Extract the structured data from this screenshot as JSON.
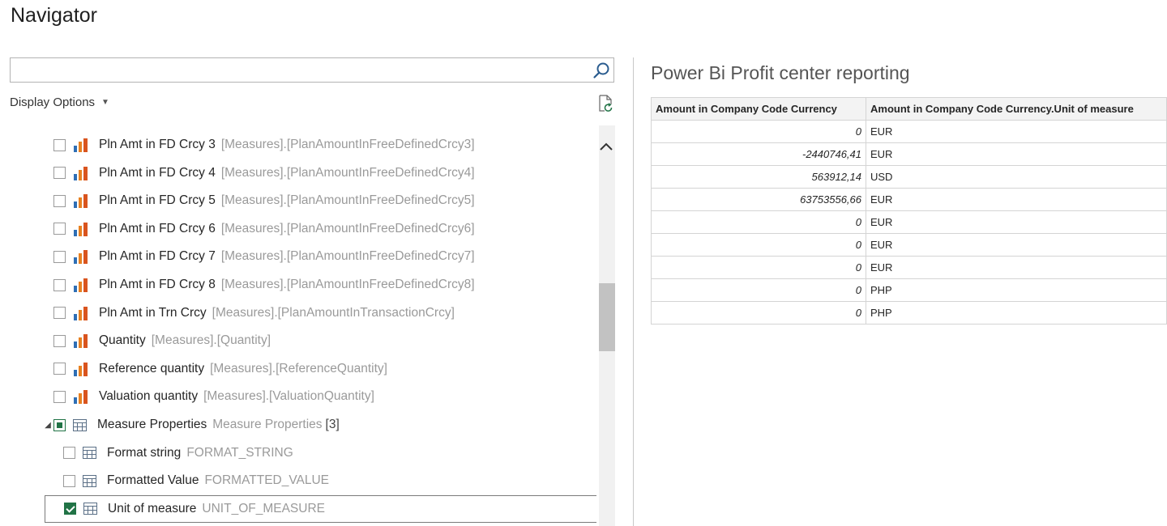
{
  "window": {
    "title": "Navigator"
  },
  "search": {
    "value": "",
    "placeholder": ""
  },
  "display_options": {
    "label": "Display Options"
  },
  "icons": {
    "search": "search-icon",
    "refresh": "refresh-file-icon",
    "measure": "bar-chart-icon",
    "table": "table-icon",
    "scroll_up": "chevron-up-icon"
  },
  "colors": {
    "check_accent": "#217346",
    "bar_orange": "#e8801f",
    "bar_blue": "#2f6fb5"
  },
  "tree": {
    "items": [
      {
        "type": "measure",
        "name": "Pln Amt in FD Crcy 3",
        "path": "[Measures].[PlanAmountInFreeDefinedCrcy3]",
        "checked": "false",
        "indent": 1
      },
      {
        "type": "measure",
        "name": "Pln Amt in FD Crcy 4",
        "path": "[Measures].[PlanAmountInFreeDefinedCrcy4]",
        "checked": "false",
        "indent": 1
      },
      {
        "type": "measure",
        "name": "Pln Amt in FD Crcy 5",
        "path": "[Measures].[PlanAmountInFreeDefinedCrcy5]",
        "checked": "false",
        "indent": 1
      },
      {
        "type": "measure",
        "name": "Pln Amt in FD Crcy 6",
        "path": "[Measures].[PlanAmountInFreeDefinedCrcy6]",
        "checked": "false",
        "indent": 1
      },
      {
        "type": "measure",
        "name": "Pln Amt in FD Crcy 7",
        "path": "[Measures].[PlanAmountInFreeDefinedCrcy7]",
        "checked": "false",
        "indent": 1
      },
      {
        "type": "measure",
        "name": "Pln Amt in FD Crcy 8",
        "path": "[Measures].[PlanAmountInFreeDefinedCrcy8]",
        "checked": "false",
        "indent": 1
      },
      {
        "type": "measure",
        "name": "Pln Amt in Trn Crcy",
        "path": "[Measures].[PlanAmountInTransactionCrcy]",
        "checked": "false",
        "indent": 1
      },
      {
        "type": "measure",
        "name": "Quantity",
        "path": "[Measures].[Quantity]",
        "checked": "false",
        "indent": 1
      },
      {
        "type": "measure",
        "name": "Reference quantity",
        "path": "[Measures].[ReferenceQuantity]",
        "checked": "false",
        "indent": 1
      },
      {
        "type": "measure",
        "name": "Valuation quantity",
        "path": "[Measures].[ValuationQuantity]",
        "checked": "false",
        "indent": 1
      },
      {
        "type": "folder",
        "name": "Measure Properties",
        "path": "Measure Properties",
        "count": "[3]",
        "checked": "partial",
        "indent": 0,
        "expanded": "true"
      },
      {
        "type": "table",
        "name": "Format string",
        "path": "FORMAT_STRING",
        "checked": "false",
        "indent": 2
      },
      {
        "type": "table",
        "name": "Formatted Value",
        "path": "FORMATTED_VALUE",
        "checked": "false",
        "indent": 2
      },
      {
        "type": "table",
        "name": "Unit of measure",
        "path": "UNIT_OF_MEASURE",
        "checked": "true",
        "indent": 2,
        "selected": "true"
      }
    ]
  },
  "preview": {
    "title": "Power Bi Profit center reporting",
    "columns": [
      "Amount in Company Code Currency",
      "Amount in Company Code Currency.Unit of measure"
    ],
    "rows": [
      [
        "0",
        "EUR"
      ],
      [
        "-2440746,41",
        "EUR"
      ],
      [
        "563912,14",
        "USD"
      ],
      [
        "63753556,66",
        "EUR"
      ],
      [
        "0",
        "EUR"
      ],
      [
        "0",
        "EUR"
      ],
      [
        "0",
        "EUR"
      ],
      [
        "0",
        "PHP"
      ],
      [
        "0",
        "PHP"
      ]
    ]
  }
}
